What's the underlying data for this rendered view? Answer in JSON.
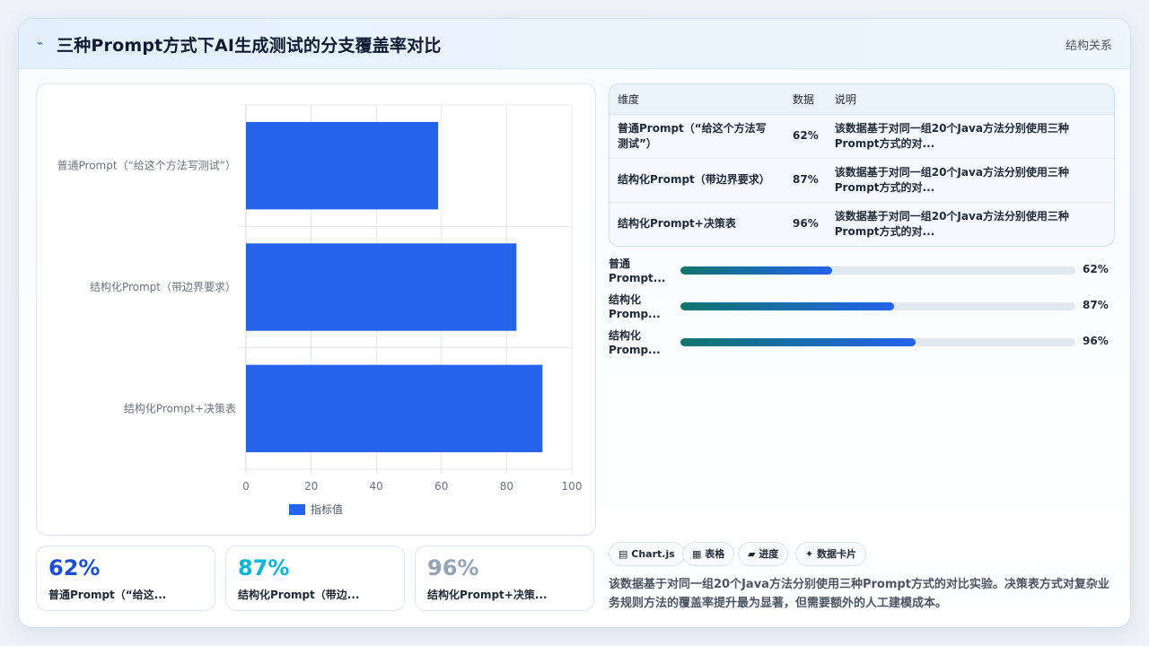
{
  "header": {
    "title": "三种Prompt方式下AI生成测试的分支覆盖率对比",
    "tag": "结构关系",
    "logo_icon": "spark-icon"
  },
  "chart_data": {
    "type": "bar",
    "orientation": "horizontal",
    "categories": [
      "普通Prompt（“给这个方法写测试”）",
      "结构化Prompt（带边界要求）",
      "结构化Prompt+决策表"
    ],
    "series": [
      {
        "name": "指标值",
        "values": [
          59,
          83,
          91
        ],
        "color": "#2563eb"
      }
    ],
    "xlim": [
      0,
      100
    ],
    "xticks": [
      "0",
      "20",
      "40",
      "60",
      "80",
      "100"
    ],
    "grid": true,
    "legend": "bottom"
  },
  "stats": [
    {
      "value": "62%",
      "label": "普通Prompt（“给这...",
      "color": "#1d4ed8"
    },
    {
      "value": "87%",
      "label": "结构化Prompt（带边...",
      "color": "#06b6d4"
    },
    {
      "value": "96%",
      "label": "结构化Prompt+决策...",
      "color": "#94a3b8"
    }
  ],
  "table": {
    "headers": [
      "维度",
      "数据",
      "说明"
    ],
    "rows": [
      {
        "dim": "普通Prompt（“给这个方法写测试”）",
        "val": "62%",
        "desc": "该数据基于对同一组20个Java方法分别使用三种Prompt方式的对..."
      },
      {
        "dim": "结构化Prompt（带边界要求）",
        "val": "87%",
        "desc": "该数据基于对同一组20个Java方法分别使用三种Prompt方式的对..."
      },
      {
        "dim": "结构化Prompt+决策表",
        "val": "96%",
        "desc": "该数据基于对同一组20个Java方法分别使用三种Prompt方式的对..."
      }
    ]
  },
  "progress": [
    {
      "label": "普通Prompt...",
      "value": "62%",
      "level": 0.385
    },
    {
      "label": "结构化Promp...",
      "value": "87%",
      "level": 0.54
    },
    {
      "label": "结构化Promp...",
      "value": "96%",
      "level": 0.595
    }
  ],
  "chips": [
    {
      "icon": "chart-icon",
      "glyph": "▤",
      "label": "Chart.js"
    },
    {
      "icon": "table-icon",
      "glyph": "▦",
      "label": "表格"
    },
    {
      "icon": "progress-icon",
      "glyph": "▰",
      "label": "进度"
    },
    {
      "icon": "sparkle-icon",
      "glyph": "✦",
      "label": "数据卡片"
    }
  ],
  "note": "该数据基于对同一组20个Java方法分别使用三种Prompt方式的对比实验。决策表方式对复杂业务规则方法的覆盖率提升最为显著，但需要额外的人工建模成本。"
}
